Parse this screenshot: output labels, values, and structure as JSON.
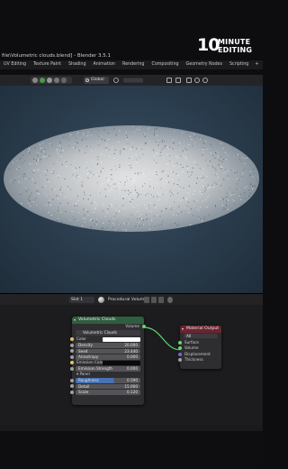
{
  "logo": {
    "number": "10",
    "line1": "MINUTE",
    "line2": "EDITING"
  },
  "window": {
    "title": "file\\Volumetric clouds.blend] - Blender 3.5.1"
  },
  "workspaces": [
    "UV Editing",
    "Texture Paint",
    "Shading",
    "Animation",
    "Rendering",
    "Compositing",
    "Geometry Nodes",
    "Scripting",
    "+"
  ],
  "viewport_header": {
    "orientation": "Global"
  },
  "node_editor_header": {
    "slot": "Slot 1",
    "material": "Procedural Volume"
  },
  "nodes": {
    "volumetric_clouds": {
      "title": "Volumetric Clouds",
      "output": "Volume",
      "group_name": "Volumetric Clouds",
      "rows": [
        {
          "label": "Color",
          "kind": "color"
        },
        {
          "label": "Density",
          "value": "20.000",
          "kind": "field"
        },
        {
          "label": "Seed",
          "value": "23.440",
          "kind": "field"
        },
        {
          "label": "Anisotropy",
          "value": "0.000",
          "kind": "field"
        },
        {
          "label": "Emission Color",
          "kind": "dark"
        },
        {
          "label": "Emission Strength",
          "value": "0.000",
          "kind": "field"
        },
        {
          "label": "Panel",
          "kind": "section"
        },
        {
          "label": "Roughness",
          "value": "0.590",
          "kind": "blue"
        },
        {
          "label": "Detail",
          "value": "15.000",
          "kind": "field"
        },
        {
          "label": "Scale",
          "value": "0.120",
          "kind": "field"
        }
      ]
    },
    "material_output": {
      "title": "Material Output",
      "target": "All",
      "sockets": [
        "Surface",
        "Volume",
        "Displacement",
        "Thickness"
      ]
    }
  },
  "colors": {
    "group_header": "#2f5e3e",
    "output_header": "#6b2530",
    "volume_socket": "#5fd96b",
    "shader_socket": "#5fd96b",
    "vector_socket": "#6b6bd9",
    "float_socket": "#a0a0a0",
    "color_socket": "#d9c85f"
  }
}
